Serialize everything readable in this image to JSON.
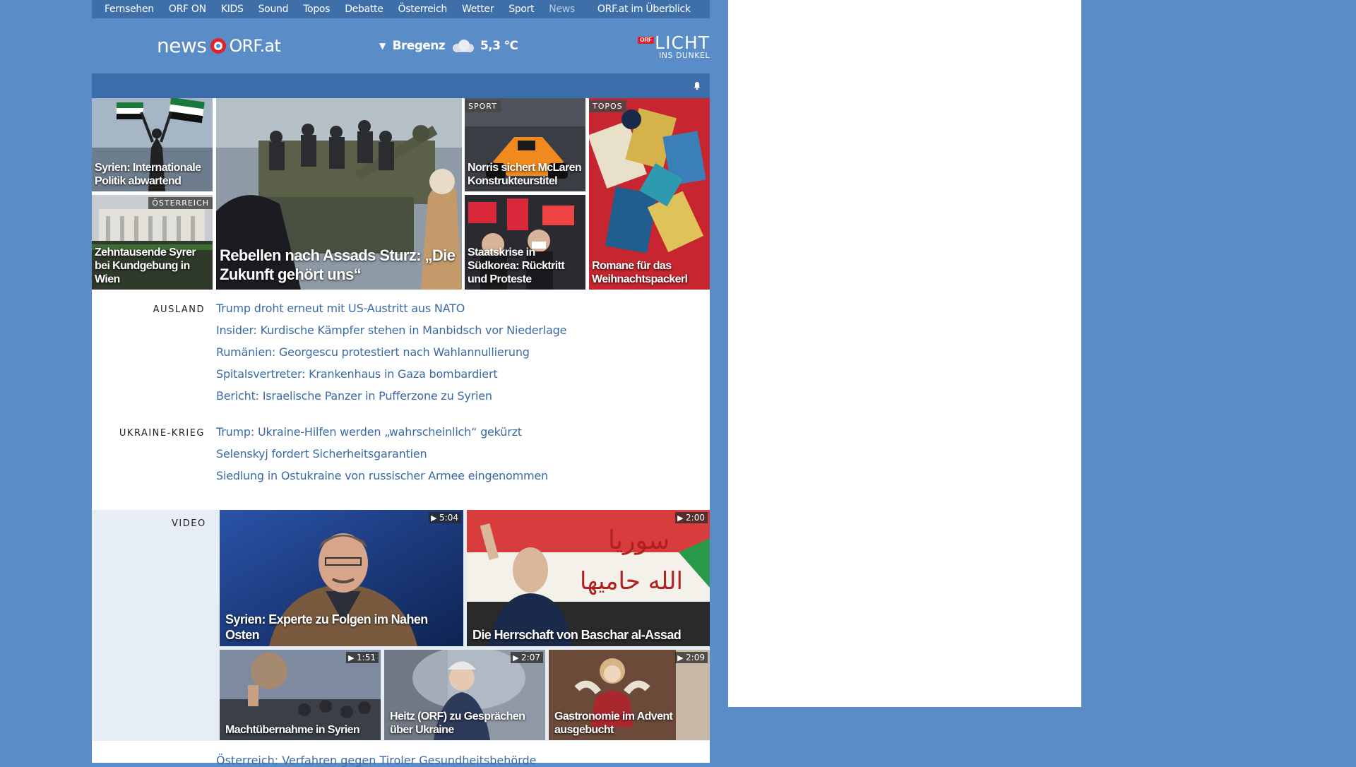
{
  "topnav": {
    "items": [
      "Fernsehen",
      "ORF ON",
      "KIDS",
      "Sound",
      "Topos",
      "Debatte",
      "Österreich",
      "Wetter",
      "Sport",
      "News"
    ],
    "active": "News",
    "overview": "ORF.at im Überblick"
  },
  "header": {
    "logo_news": "news",
    "logo_site": "ORF.at",
    "weather_location": "Bregenz",
    "weather_temp": "5,3 °C",
    "licht_badge": "ORF",
    "licht_line1": "LICHT",
    "licht_line2": "INS DUNKEL"
  },
  "teasers": [
    {
      "title": "Syrien: Internationale Politik abwartend",
      "tag": ""
    },
    {
      "title": "Rebellen nach Assads Sturz: „Die Zukunft gehört uns“",
      "tag": ""
    },
    {
      "title": "Norris sichert McLaren Konstrukteurstitel",
      "tag": "SPORT"
    },
    {
      "title": "Romane für das Weihnachtspackerl",
      "tag": "TOPOS"
    },
    {
      "title": "Zehntausende Syrer bei Kundgebung in Wien",
      "tag": "ÖSTERREICH"
    },
    {
      "title": "Staatskrise in Südkorea: Rücktritt und Proteste",
      "tag": ""
    }
  ],
  "sections": [
    {
      "label": "AUSLAND",
      "links": [
        "Trump droht erneut mit US-Austritt aus NATO",
        "Insider: Kurdische Kämpfer stehen in Manbidsch vor Niederlage",
        "Rumänien: Georgescu protestiert nach Wahlannullierung",
        "Spitalsvertreter: Krankenhaus in Gaza bombardiert",
        "Bericht: Israelische Panzer in Pufferzone zu Syrien"
      ]
    },
    {
      "label": "UKRAINE-KRIEG",
      "links": [
        "Trump: Ukraine-Hilfen werden „wahrscheinlich“ gekürzt",
        "Selenskyj fordert Sicherheitsgarantien",
        "Siedlung in Ostukraine von russischer Armee eingenommen"
      ]
    }
  ],
  "video": {
    "label": "VIDEO",
    "items": [
      {
        "title": "Syrien: Experte zu Folgen im Nahen Osten",
        "duration": "5:04"
      },
      {
        "title": "Die Herrschaft von Baschar al-Assad",
        "duration": "2:00"
      },
      {
        "title": "Machtübernahme in Syrien",
        "duration": "1:51"
      },
      {
        "title": "Heitz (ORF) zu Gesprächen über Ukraine",
        "duration": "2:07"
      },
      {
        "title": "Gastronomie im Advent ausgebucht",
        "duration": "2:09"
      }
    ]
  },
  "cutoff_line": "Österreich: Verfahren gegen Tiroler Gesundheitsbehörde"
}
